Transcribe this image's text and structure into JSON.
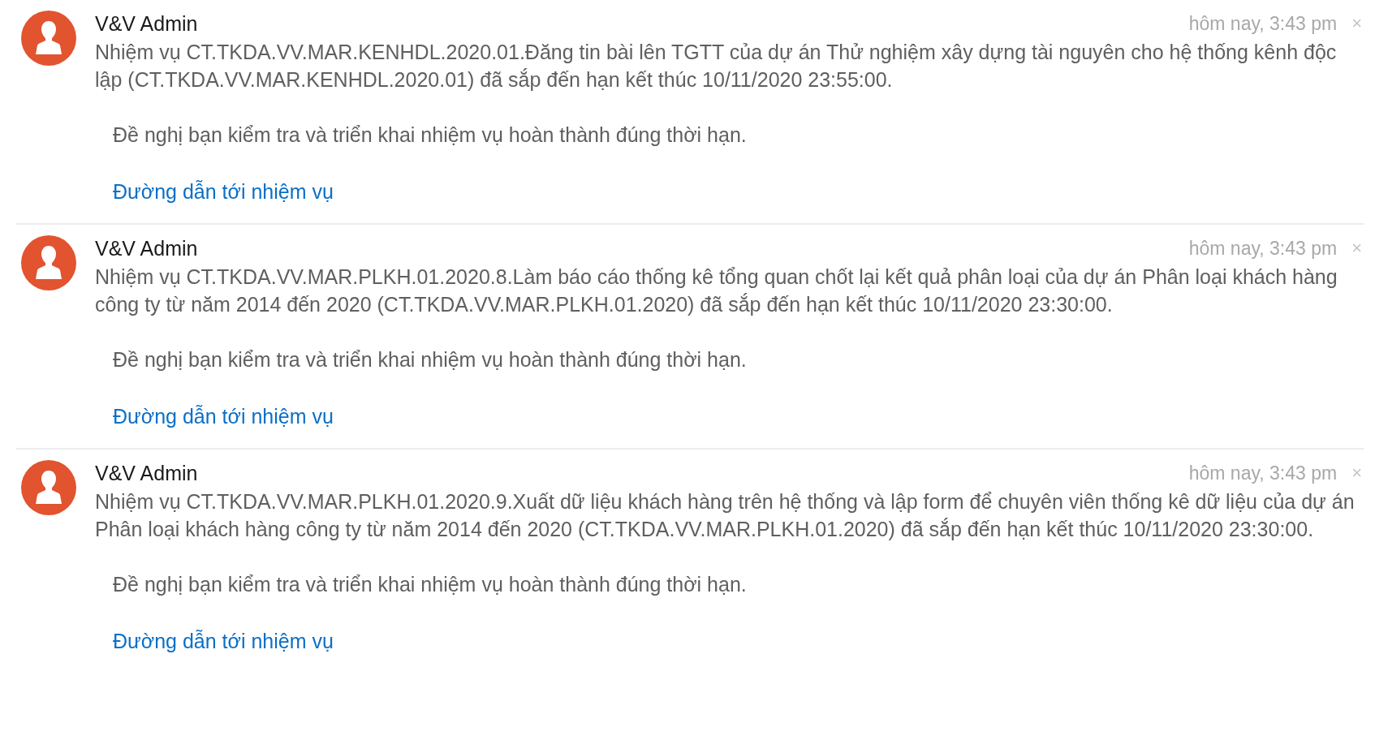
{
  "notifications": [
    {
      "sender": "V&V Admin",
      "time": "hôm nay, 3:43 pm",
      "close": "×",
      "message": "Nhiệm vụ CT.TKDA.VV.MAR.KENHDL.2020.01.Đăng tin bài lên TGTT của dự án Thử nghiệm xây dựng tài nguyên cho hệ thống kênh độc lập (CT.TKDA.VV.MAR.KENHDL.2020.01) đã sắp đến hạn kết thúc 10/11/2020 23:55:00.",
      "request": "Đề nghị bạn kiểm tra và triển khai nhiệm vụ hoàn thành đúng thời hạn.",
      "link": "Đường dẫn tới nhiệm vụ"
    },
    {
      "sender": "V&V Admin",
      "time": "hôm nay, 3:43 pm",
      "close": "×",
      "message": "Nhiệm vụ CT.TKDA.VV.MAR.PLKH.01.2020.8.Làm báo cáo thống kê tổng quan chốt lại kết quả phân loại của dự án Phân loại khách hàng công ty từ năm 2014 đến 2020 (CT.TKDA.VV.MAR.PLKH.01.2020) đã sắp đến hạn kết thúc 10/11/2020 23:30:00.",
      "request": "Đề nghị bạn kiểm tra và triển khai nhiệm vụ hoàn thành đúng thời hạn.",
      "link": "Đường dẫn tới nhiệm vụ"
    },
    {
      "sender": "V&V Admin",
      "time": "hôm nay, 3:43 pm",
      "close": "×",
      "message": "Nhiệm vụ CT.TKDA.VV.MAR.PLKH.01.2020.9.Xuất dữ liệu khách hàng trên hệ thống và lập form để chuyên viên thống kê dữ liệu của dự án Phân loại khách hàng công ty từ năm 2014 đến 2020 (CT.TKDA.VV.MAR.PLKH.01.2020) đã sắp đến hạn kết thúc 10/11/2020 23:30:00.",
      "request": "Đề nghị bạn kiểm tra và triển khai nhiệm vụ hoàn thành đúng thời hạn.",
      "link": "Đường dẫn tới nhiệm vụ"
    }
  ]
}
